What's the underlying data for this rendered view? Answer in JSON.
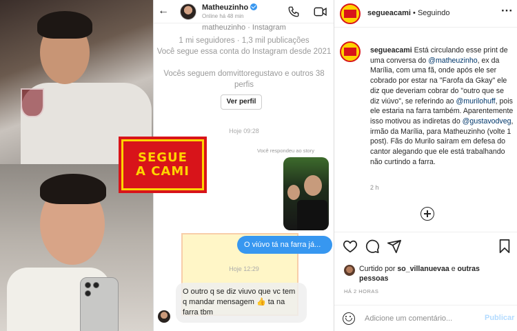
{
  "logo": {
    "line1": "SEGUE",
    "line2": "A CAMI"
  },
  "dm": {
    "username": "Matheuzinho",
    "online_status": "Online há 48 min",
    "handle": "matheuzinho · Instagram",
    "stats": "1 mi seguidores · 1,3 mil publicações",
    "follow_info": "Você segue essa conta do Instagram desde 2021",
    "mutual": "Vocês seguem domvittoregustavo e outros 38 perfis",
    "profile_button": "Ver perfil",
    "time1": "Hoje 09:28",
    "replied_story": "Você respondeu ao story",
    "sent_message": "O viúvo tá na farra já...",
    "time2": "Hoje 12:29",
    "received_message": "O outro q se diz viuvo que vc tem q mandar mensagem 👍 ta na farra tbm",
    "back_icon": "back-arrow-icon"
  },
  "ig": {
    "username": "segueacami",
    "following": " • Seguindo",
    "more_label": "···",
    "caption": {
      "user": "segueacami",
      "t1": " Está circulando esse print de uma conversa do ",
      "m1": "@matheuzinho",
      "t2": ", ex da Marília, com uma fã, onde após ele ser cobrado por estar na \"Farofa da Gkay\" ele diz que deveriam cobrar do \"outro que se diz viúvo\", se referindo ao ",
      "m2": "@murilohuff",
      "t3": ", pois ele estaria na farra também. Aparentemente isso motivou as indiretas do ",
      "m3": "@gustavodveg",
      "t4": ", irmão da Marília, para Matheuzinho (volte 1 post). Fãs do Murilo saíram em defesa do cantor alegando que ele está trabalhando não curtindo a farra."
    },
    "caption_age": "2 h",
    "liked_prefix": "Curtido por ",
    "liked_user": "so_villanuevaa",
    "liked_mid": " e ",
    "liked_others": "outras pessoas",
    "ago": "HÁ 2 HORAS",
    "comment_placeholder": "Adicione um comentário...",
    "post_button": "Publicar",
    "accent": "#3797f0"
  }
}
